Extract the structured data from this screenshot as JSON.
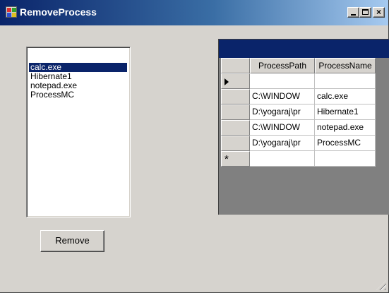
{
  "window": {
    "title": "RemoveProcess",
    "close_symbol": "×"
  },
  "process_list": {
    "items": [
      {
        "label": "calc.exe",
        "selected": true
      },
      {
        "label": "Hibernate1",
        "selected": false
      },
      {
        "label": "notepad.exe",
        "selected": false
      },
      {
        "label": "ProcessMC",
        "selected": false
      }
    ]
  },
  "process_grid": {
    "columns": [
      "ProcessPath",
      "ProcessName"
    ],
    "rows": [
      {
        "path": "",
        "name": "",
        "row_marker": "current-row-arrow"
      },
      {
        "path": "C:\\WINDOW",
        "name": "calc.exe"
      },
      {
        "path": "D:\\yogaraj\\pr",
        "name": "Hibernate1"
      },
      {
        "path": "C:\\WINDOW",
        "name": "notepad.exe"
      },
      {
        "path": "D:\\yogaraj\\pr",
        "name": "ProcessMC"
      },
      {
        "path": "",
        "name": "",
        "row_marker": "*"
      }
    ]
  },
  "actions": {
    "remove_label": "Remove"
  },
  "colors": {
    "title_bar_start": "#0a246a",
    "title_bar_end": "#a6caf0",
    "selection": "#0a246a",
    "form_background": "#d6d3ce",
    "grid_background": "#808080"
  }
}
